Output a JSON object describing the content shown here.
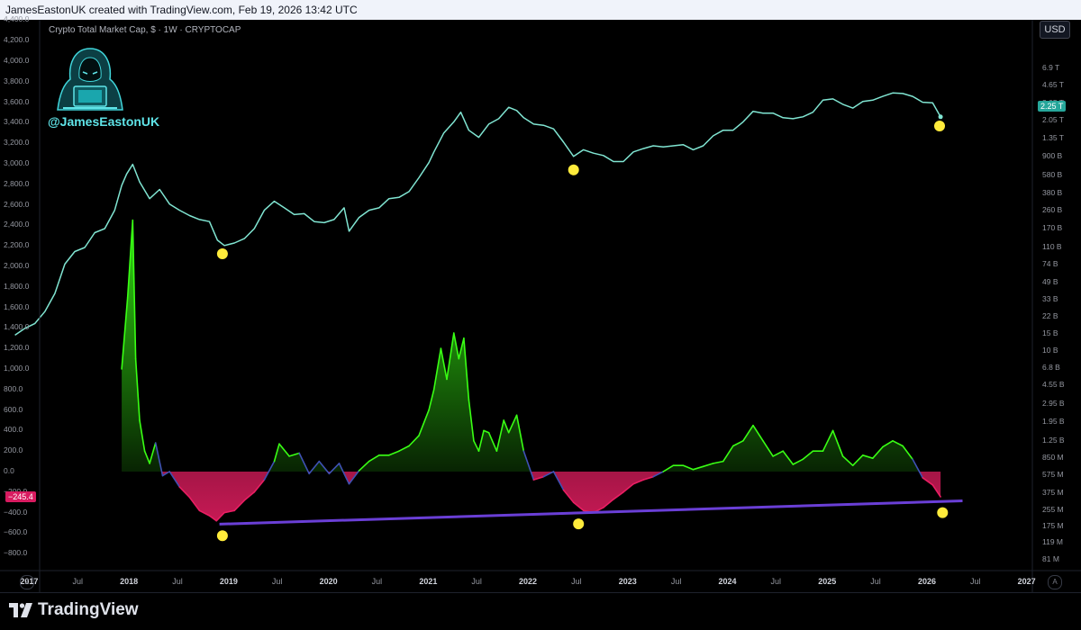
{
  "header": {
    "credit": "JamesEastonUK created with TradingView.com, Feb 19, 2026 13:42 UTC"
  },
  "chart": {
    "title": "Crypto Total Market Cap, $ · 1W · CRYPTOCAP",
    "currency_button": "USD",
    "watermark_handle": "@JamesEastonUK"
  },
  "footer": {
    "brand": "TradingView",
    "left_corner": "Z",
    "right_corner": "A"
  },
  "colors": {
    "price_line": "#80e5d2",
    "osc_up": "#39ff14",
    "osc_down": "#e91e63",
    "osc_neutral": "#3f51b5",
    "trendline": "#6a3fd6",
    "marker": "#ffeb3b"
  },
  "chart_data": {
    "type": "line",
    "x_ticks": [
      "2017",
      "Jul",
      "2018",
      "Jul",
      "2019",
      "Jul",
      "2020",
      "Jul",
      "2021",
      "Jul",
      "2022",
      "Jul",
      "2023",
      "Jul",
      "2024",
      "Jul",
      "2025",
      "Jul",
      "2026",
      "Jul",
      "2027"
    ],
    "x_major": [
      "2017",
      "2018",
      "2019",
      "2020",
      "2021",
      "2022",
      "2023",
      "2024",
      "2025",
      "2026",
      "2027"
    ],
    "left_axis_labels": [
      "4,400.0",
      "4,200.0",
      "4,000.0",
      "3,800.0",
      "3,600.0",
      "3,400.0",
      "3,200.0",
      "3,000.0",
      "2,800.0",
      "2,600.0",
      "2,400.0",
      "2,200.0",
      "2,000.0",
      "1,800.0",
      "1,600.0",
      "1,400.0",
      "1,200.0",
      "1,000.0",
      "800.0",
      "600.0",
      "400.0",
      "200.0",
      "0.0",
      "−200.0",
      "−400.0",
      "−600.0",
      "−800.0"
    ],
    "right_axis_labels": [
      "6.9 T",
      "4.65 T",
      "3.05 T",
      "2.05 T",
      "1.35 T",
      "900 B",
      "580 B",
      "380 B",
      "260 B",
      "170 B",
      "110 B",
      "74 B",
      "49 B",
      "33 B",
      "22 B",
      "15 B",
      "10 B",
      "6.8 B",
      "4.55 B",
      "2.95 B",
      "1.95 B",
      "1.25 B",
      "850 M",
      "575 M",
      "375 M",
      "255 M",
      "175 M",
      "119 M",
      "81 M"
    ],
    "last_price_label": "2.25 T",
    "last_osc_label": "−245.4",
    "series": [
      {
        "name": "Crypto Total Market Cap",
        "scale": "log",
        "x": [
          2016.85,
          2016.95,
          2017.05,
          2017.15,
          2017.25,
          2017.35,
          2017.45,
          2017.55,
          2017.65,
          2017.75,
          2017.85,
          2017.92,
          2017.97,
          2018.03,
          2018.1,
          2018.2,
          2018.3,
          2018.4,
          2018.5,
          2018.6,
          2018.7,
          2018.8,
          2018.88,
          2018.95,
          2019.05,
          2019.15,
          2019.25,
          2019.35,
          2019.45,
          2019.55,
          2019.65,
          2019.75,
          2019.85,
          2019.95,
          2020.05,
          2020.15,
          2020.2,
          2020.3,
          2020.4,
          2020.5,
          2020.6,
          2020.7,
          2020.8,
          2020.9,
          2021.0,
          2021.05,
          2021.15,
          2021.25,
          2021.32,
          2021.4,
          2021.5,
          2021.6,
          2021.7,
          2021.8,
          2021.88,
          2021.95,
          2022.05,
          2022.15,
          2022.25,
          2022.35,
          2022.45,
          2022.55,
          2022.65,
          2022.75,
          2022.85,
          2022.95,
          2023.05,
          2023.15,
          2023.25,
          2023.35,
          2023.45,
          2023.55,
          2023.65,
          2023.75,
          2023.85,
          2023.95,
          2024.05,
          2024.15,
          2024.25,
          2024.35,
          2024.45,
          2024.55,
          2024.65,
          2024.75,
          2024.85,
          2024.95,
          2025.05,
          2025.15,
          2025.25,
          2025.35,
          2025.45,
          2025.55,
          2025.65,
          2025.75,
          2025.85,
          2025.95,
          2026.05,
          2026.13
        ],
        "values": [
          14500000000.0,
          17000000000.0,
          19000000000.0,
          25000000000.0,
          38000000000.0,
          75000000000.0,
          100000000000.0,
          110000000000.0,
          155000000000.0,
          170000000000.0,
          260000000000.0,
          460000000000.0,
          600000000000.0,
          750000000000.0,
          500000000000.0,
          340000000000.0,
          420000000000.0,
          300000000000.0,
          260000000000.0,
          230000000000.0,
          210000000000.0,
          200000000000.0,
          130000000000.0,
          115000000000.0,
          122000000000.0,
          135000000000.0,
          170000000000.0,
          260000000000.0,
          320000000000.0,
          275000000000.0,
          235000000000.0,
          240000000000.0,
          200000000000.0,
          195000000000.0,
          210000000000.0,
          275000000000.0,
          160000000000.0,
          220000000000.0,
          260000000000.0,
          275000000000.0,
          340000000000.0,
          350000000000.0,
          400000000000.0,
          550000000000.0,
          780000000000.0,
          1000000000000.0,
          1550000000000.0,
          2000000000000.0,
          2500000000000.0,
          1650000000000.0,
          1400000000000.0,
          1900000000000.0,
          2150000000000.0,
          2800000000000.0,
          2600000000000.0,
          2200000000000.0,
          1900000000000.0,
          1850000000000.0,
          1700000000000.0,
          1250000000000.0,
          900000000000.0,
          1050000000000.0,
          970000000000.0,
          920000000000.0,
          800000000000.0,
          800000000000.0,
          1000000000000.0,
          1080000000000.0,
          1150000000000.0,
          1120000000000.0,
          1150000000000.0,
          1180000000000.0,
          1050000000000.0,
          1150000000000.0,
          1450000000000.0,
          1650000000000.0,
          1650000000000.0,
          2000000000000.0,
          2550000000000.0,
          2450000000000.0,
          2450000000000.0,
          2200000000000.0,
          2150000000000.0,
          2250000000000.0,
          2500000000000.0,
          3300000000000.0,
          3400000000000.0,
          3000000000000.0,
          2750000000000.0,
          3200000000000.0,
          3300000000000.0,
          3600000000000.0,
          3900000000000.0,
          3850000000000.0,
          3600000000000.0,
          3150000000000.0,
          3100000000000.0,
          2250000000000.0
        ]
      },
      {
        "name": "Oscillator",
        "scale": "linear",
        "x": [
          2017.92,
          2017.98,
          2018.03,
          2018.06,
          2018.1,
          2018.15,
          2018.2,
          2018.26,
          2018.33,
          2018.4,
          2018.5,
          2018.6,
          2018.7,
          2018.8,
          2018.87,
          2018.95,
          2019.05,
          2019.15,
          2019.25,
          2019.35,
          2019.45,
          2019.5,
          2019.6,
          2019.7,
          2019.8,
          2019.9,
          2020.0,
          2020.1,
          2020.2,
          2020.3,
          2020.4,
          2020.5,
          2020.6,
          2020.7,
          2020.8,
          2020.9,
          2021.0,
          2021.05,
          2021.12,
          2021.18,
          2021.25,
          2021.3,
          2021.35,
          2021.4,
          2021.45,
          2021.5,
          2021.55,
          2021.6,
          2021.68,
          2021.75,
          2021.8,
          2021.88,
          2021.95,
          2022.05,
          2022.15,
          2022.25,
          2022.35,
          2022.45,
          2022.55,
          2022.65,
          2022.75,
          2022.85,
          2022.95,
          2023.05,
          2023.15,
          2023.25,
          2023.35,
          2023.45,
          2023.55,
          2023.65,
          2023.75,
          2023.85,
          2023.95,
          2024.05,
          2024.15,
          2024.25,
          2024.35,
          2024.45,
          2024.55,
          2024.65,
          2024.75,
          2024.85,
          2024.95,
          2025.05,
          2025.15,
          2025.25,
          2025.35,
          2025.45,
          2025.55,
          2025.65,
          2025.75,
          2025.85,
          2025.95,
          2026.05,
          2026.13
        ],
        "values": [
          1000,
          1700,
          2450,
          1100,
          500,
          200,
          80,
          280,
          -40,
          0,
          -150,
          -250,
          -380,
          -430,
          -480,
          -400,
          -380,
          -280,
          -200,
          -80,
          100,
          270,
          150,
          180,
          -20,
          100,
          -20,
          80,
          -120,
          10,
          100,
          160,
          160,
          200,
          250,
          350,
          600,
          800,
          1200,
          900,
          1350,
          1100,
          1300,
          700,
          300,
          200,
          400,
          380,
          200,
          500,
          380,
          550,
          200,
          -80,
          -50,
          0,
          -180,
          -300,
          -380,
          -400,
          -350,
          -270,
          -200,
          -120,
          -80,
          -50,
          0,
          60,
          60,
          20,
          50,
          80,
          100,
          250,
          300,
          450,
          300,
          150,
          200,
          70,
          120,
          200,
          200,
          400,
          150,
          60,
          160,
          130,
          240,
          300,
          250,
          120,
          -60,
          -130,
          -245.4
        ]
      }
    ],
    "annotations": [
      {
        "type": "trendline",
        "x": [
          2018.9,
          2026.35
        ],
        "y": [
          -512,
          -285
        ]
      },
      {
        "type": "marker",
        "series": "Crypto Total Market Cap",
        "x": [
          2018.93,
          2022.45,
          2026.12
        ],
        "y": [
          95000000000.0,
          660000000000.0,
          1820000000000.0
        ]
      },
      {
        "type": "marker",
        "series": "Oscillator",
        "x": [
          2018.93,
          2022.5,
          2026.15
        ],
        "y": [
          -625,
          -510,
          -400
        ]
      }
    ],
    "left_axis_range": [
      -800,
      4400
    ],
    "right_axis_range_log": [
      81000000.0,
      10000000000000.0
    ],
    "x_range": [
      2016.7,
      2027.05
    ],
    "grid": false
  }
}
